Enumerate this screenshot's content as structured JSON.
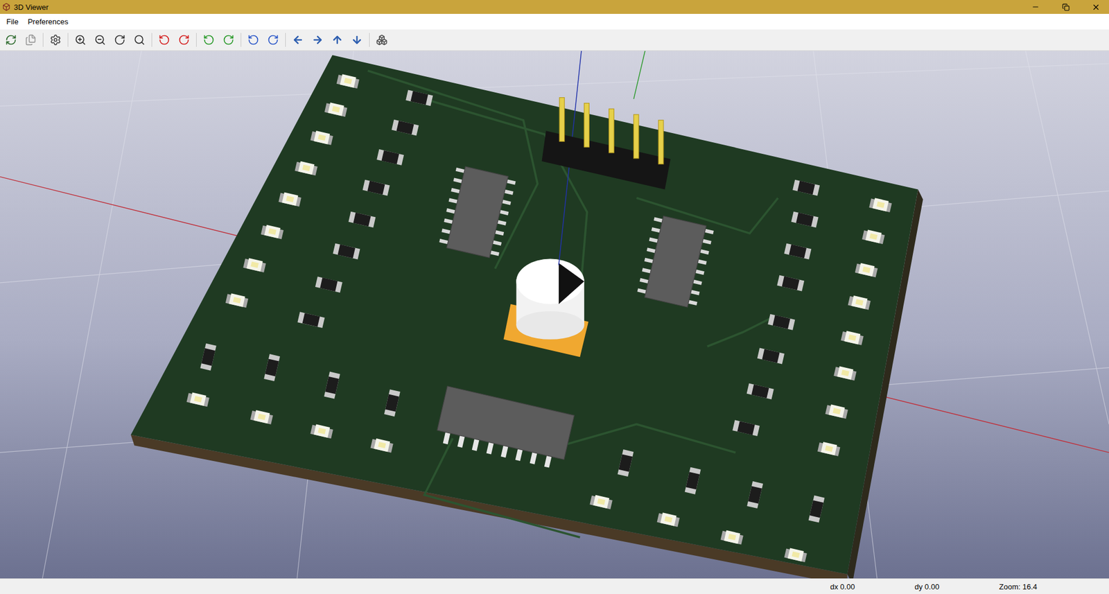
{
  "window": {
    "title": "3D Viewer"
  },
  "menu": [
    "File",
    "Preferences"
  ],
  "status_bar": {
    "dx": "dx 0.00",
    "dy": "dy 0.00",
    "zoom": "Zoom: 16.4"
  }
}
